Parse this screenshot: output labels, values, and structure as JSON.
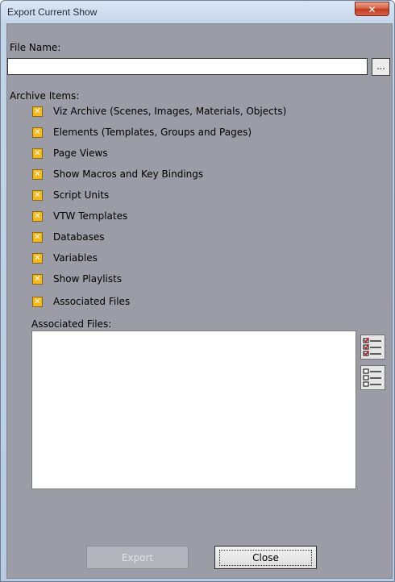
{
  "window": {
    "title": "Export Current Show",
    "close_glyph": "✕"
  },
  "file_name": {
    "label": "File Name:",
    "value": "",
    "placeholder": "",
    "browse_label": "..."
  },
  "archive_items": {
    "label": "Archive Items:",
    "check_glyph": "✕",
    "items": [
      {
        "label": "Viz Archive (Scenes, Images, Materials, Objects)",
        "checked": true
      },
      {
        "label": "Elements (Templates, Groups and Pages)",
        "checked": true
      },
      {
        "label": "Page Views",
        "checked": true
      },
      {
        "label": "Show Macros and Key Bindings",
        "checked": true
      },
      {
        "label": "Script Units",
        "checked": true
      },
      {
        "label": "VTW Templates",
        "checked": true
      },
      {
        "label": "Databases",
        "checked": true
      },
      {
        "label": "Variables",
        "checked": true
      },
      {
        "label": "Show Playlists",
        "checked": true
      },
      {
        "label": "Associated Files",
        "checked": true
      }
    ]
  },
  "associated_files": {
    "label": "Associated Files:",
    "select_all_icon": "check-list-icon",
    "deselect_all_icon": "empty-list-icon"
  },
  "footer": {
    "export_label": "Export",
    "export_enabled": false,
    "close_label": "Close"
  },
  "colors": {
    "client_bg": "#9c9ca6",
    "checkbox_fill": "#f2b81c",
    "close_red": "#c0391c"
  }
}
